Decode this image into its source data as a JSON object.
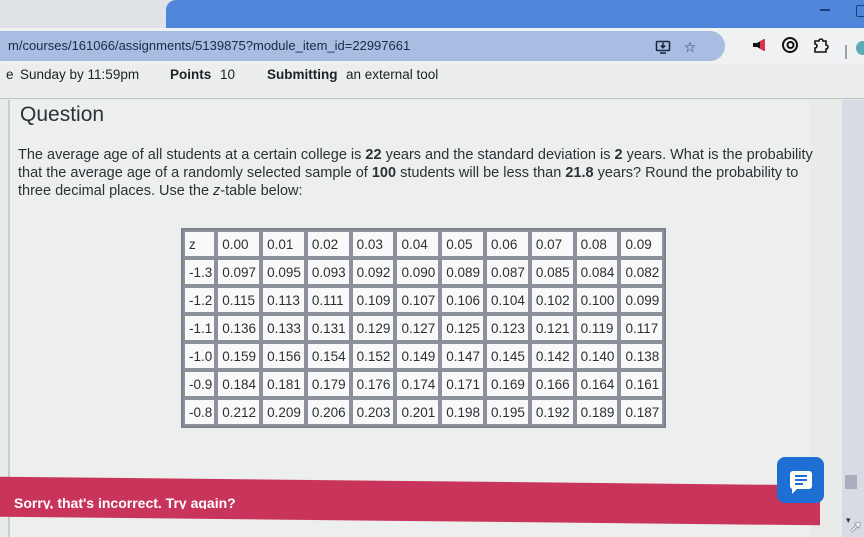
{
  "browser": {
    "url": "m/courses/161066/assignments/5139875?module_item_id=22997661",
    "toolbar_icons": [
      "install-app-icon",
      "bookmark-star-icon",
      "megaphone-extension-icon",
      "grammarly-extension-icon",
      "extensions-puzzle-icon"
    ],
    "window_controls": [
      "minimize-icon",
      "maximize-icon"
    ]
  },
  "assignment": {
    "due_fragment": "e",
    "due": "Sunday by 11:59pm",
    "points_label": "Points",
    "points_value": "10",
    "submitting_label": "Submitting",
    "submitting_value": "an external tool"
  },
  "question": {
    "title": "Question",
    "text_parts": {
      "p1": "The average age of all students at a certain college is ",
      "mean": "22",
      "p2": " years and the standard deviation is ",
      "sd": "2",
      "p3": " years. What is the probability that the average age of a randomly selected sample of ",
      "n": "100",
      "p4": " students will be less than ",
      "x": "21.8",
      "p5": " years? Round the probability to three decimal places. Use the ",
      "zvar": "z",
      "p6": "-table below:"
    }
  },
  "z_table": {
    "header": [
      "z",
      "0.00",
      "0.01",
      "0.02",
      "0.03",
      "0.04",
      "0.05",
      "0.06",
      "0.07",
      "0.08",
      "0.09"
    ],
    "rows": [
      [
        "-1.3",
        "0.097",
        "0.095",
        "0.093",
        "0.092",
        "0.090",
        "0.089",
        "0.087",
        "0.085",
        "0.084",
        "0.082"
      ],
      [
        "-1.2",
        "0.115",
        "0.113",
        "0.111",
        "0.109",
        "0.107",
        "0.106",
        "0.104",
        "0.102",
        "0.100",
        "0.099"
      ],
      [
        "-1.1",
        "0.136",
        "0.133",
        "0.131",
        "0.129",
        "0.127",
        "0.125",
        "0.123",
        "0.121",
        "0.119",
        "0.117"
      ],
      [
        "-1.0",
        "0.159",
        "0.156",
        "0.154",
        "0.152",
        "0.149",
        "0.147",
        "0.145",
        "0.142",
        "0.140",
        "0.138"
      ],
      [
        "-0.9",
        "0.184",
        "0.181",
        "0.179",
        "0.176",
        "0.174",
        "0.171",
        "0.169",
        "0.166",
        "0.164",
        "0.161"
      ],
      [
        "-0.8",
        "0.212",
        "0.209",
        "0.206",
        "0.203",
        "0.201",
        "0.198",
        "0.195",
        "0.192",
        "0.189",
        "0.187"
      ]
    ]
  },
  "feedback": {
    "message": "Sorry, that's incorrect. Try again?",
    "color": "#c9355a"
  },
  "chat_button": {
    "icon": "chat-message-icon",
    "color": "#1e6ed4"
  }
}
